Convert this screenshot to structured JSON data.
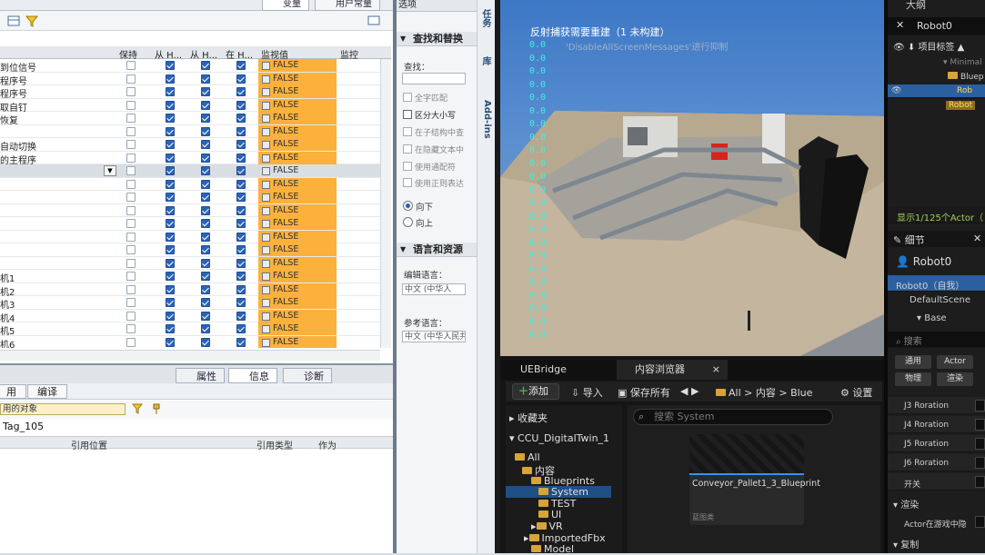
{
  "tia": {
    "top_tabs": [
      "变量",
      "用户常量"
    ],
    "columns": [
      "保持",
      "从 H...",
      "从 H...",
      "在 H...",
      "监视值",
      "监控"
    ],
    "rows": [
      {
        "name": "到位信号",
        "retain": false,
        "a": true,
        "b": true,
        "c": true,
        "value": "FALSE",
        "highlight": true
      },
      {
        "name": "程序号",
        "retain": false,
        "a": true,
        "b": true,
        "c": true,
        "value": "FALSE",
        "highlight": true
      },
      {
        "name": "程序号",
        "retain": false,
        "a": true,
        "b": true,
        "c": true,
        "value": "FALSE",
        "highlight": true
      },
      {
        "name": "取自钉",
        "retain": false,
        "a": true,
        "b": true,
        "c": true,
        "value": "FALSE",
        "highlight": true
      },
      {
        "name": "恢复",
        "retain": false,
        "a": true,
        "b": true,
        "c": true,
        "value": "FALSE",
        "highlight": true
      },
      {
        "name": "",
        "retain": false,
        "a": true,
        "b": true,
        "c": true,
        "value": "FALSE",
        "highlight": true
      },
      {
        "name": "自动切换",
        "retain": false,
        "a": true,
        "b": true,
        "c": true,
        "value": "FALSE",
        "highlight": true
      },
      {
        "name": "的主程序",
        "retain": false,
        "a": true,
        "b": true,
        "c": true,
        "value": "FALSE",
        "highlight": true
      },
      {
        "name": "",
        "retain": false,
        "a": true,
        "b": true,
        "c": true,
        "value": "FALSE",
        "highlight": false,
        "selected": true
      },
      {
        "name": "",
        "retain": false,
        "a": true,
        "b": true,
        "c": true,
        "value": "FALSE",
        "highlight": true
      },
      {
        "name": "",
        "retain": false,
        "a": true,
        "b": true,
        "c": true,
        "value": "FALSE",
        "highlight": true
      },
      {
        "name": "",
        "retain": false,
        "a": true,
        "b": true,
        "c": true,
        "value": "FALSE",
        "highlight": true
      },
      {
        "name": "",
        "retain": false,
        "a": true,
        "b": true,
        "c": true,
        "value": "FALSE",
        "highlight": true
      },
      {
        "name": "",
        "retain": false,
        "a": true,
        "b": true,
        "c": true,
        "value": "FALSE",
        "highlight": true
      },
      {
        "name": "",
        "retain": false,
        "a": true,
        "b": true,
        "c": true,
        "value": "FALSE",
        "highlight": true
      },
      {
        "name": "",
        "retain": false,
        "a": true,
        "b": true,
        "c": true,
        "value": "FALSE",
        "highlight": true
      },
      {
        "name": "机1",
        "retain": false,
        "a": true,
        "b": true,
        "c": true,
        "value": "FALSE",
        "highlight": true
      },
      {
        "name": "机2",
        "retain": false,
        "a": true,
        "b": true,
        "c": true,
        "value": "FALSE",
        "highlight": true
      },
      {
        "name": "机3",
        "retain": false,
        "a": true,
        "b": true,
        "c": true,
        "value": "FALSE",
        "highlight": true
      },
      {
        "name": "机4",
        "retain": false,
        "a": true,
        "b": true,
        "c": true,
        "value": "FALSE",
        "highlight": true
      },
      {
        "name": "机5",
        "retain": false,
        "a": true,
        "b": true,
        "c": true,
        "value": "FALSE",
        "highlight": true
      },
      {
        "name": "机6",
        "retain": false,
        "a": true,
        "b": true,
        "c": true,
        "value": "FALSE",
        "highlight": true
      }
    ],
    "inspector_tabs": [
      "属性",
      "信息",
      "诊断"
    ],
    "sub_tabs": [
      "用",
      "编译"
    ],
    "filter_value": "用的对象",
    "tag_name": "Tag_105",
    "ref_columns": [
      "引用位置",
      "引用类型",
      "作为"
    ],
    "highlight_color": "#fbb13c"
  },
  "options": {
    "title": "选项",
    "find_replace": "查找和替换",
    "find_label": "查找：",
    "checks": [
      "全字匹配",
      "区分大小写",
      "在子结构中查",
      "在隐藏文本中",
      "使用通配符",
      "使用正则表达"
    ],
    "dir_down": "向下",
    "dir_up": "向上",
    "lang_section": "语言和资源",
    "edit_lang_label": "编辑语言：",
    "edit_lang_value": "中文 (中华人",
    "ref_lang_label": "参考语言：",
    "ref_lang_value": "中文 (中华人民共",
    "side_tabs": [
      "任务",
      "库",
      "Add-ins"
    ]
  },
  "viewport": {
    "msg1": "反射捕获需要重建（1 未构建）",
    "msg2": "'DisableAllScreenMessages'进行抑制",
    "zero_value": "0.0",
    "sky_color": "#3d78c6"
  },
  "content_browser": {
    "tabs": [
      "UEBridge",
      "内容浏览器"
    ],
    "add": "添加",
    "import": "导入",
    "save_all": "保存所有",
    "path": [
      "All",
      "内容",
      "Blue"
    ],
    "settings": "设置",
    "favorites": "收藏夹",
    "project": "CCU_DigitalTwin_1",
    "tree": [
      "All",
      "内容",
      "Blueprints",
      "System",
      "TEST",
      "UI",
      "VR",
      "ImportedFbx",
      "Model"
    ],
    "search_placeholder": "搜索 System",
    "asset_name": "Conveyor_Pallet1_3_Blueprint",
    "asset_type": "蓝图类"
  },
  "right_panel": {
    "outliner_title": "大纲",
    "outliner_search": "Robot0",
    "item_label_col": "项目标签",
    "tree": [
      "Minimal",
      "Bluep",
      "Rob",
      "Robot"
    ],
    "actor_count": "显示1/125个Actor（",
    "details_title": "细节",
    "actor_name": "Robot0",
    "self_label": "Robot0（自我）",
    "component1": "DefaultScene",
    "component2": "Base",
    "search": "搜索",
    "filter_buttons": [
      "通用",
      "Actor",
      "物理",
      "渲染"
    ],
    "props": [
      "J3 Roration",
      "J4 Roration",
      "J5 Roration",
      "J6 Roration",
      "开关"
    ],
    "render_section": "渲染",
    "hidden_in_game": "Actor在游戏中隐",
    "copy_section": "复制"
  }
}
